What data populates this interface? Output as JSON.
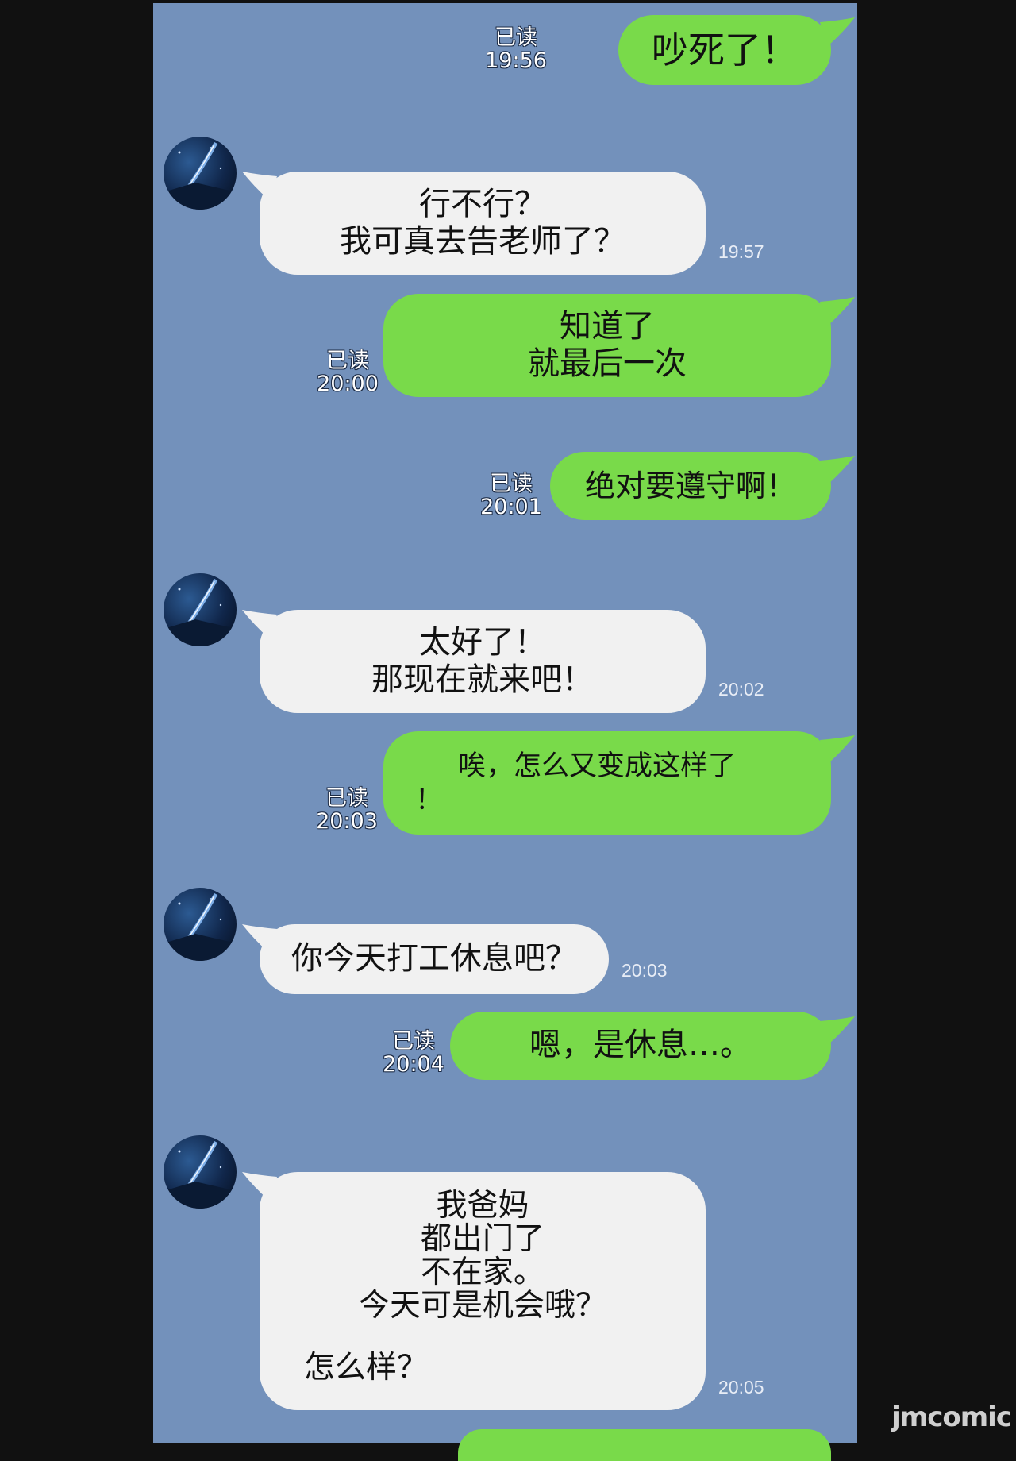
{
  "colors": {
    "chat_background": "#7391bb",
    "outgoing_bubble": "#79da4a",
    "incoming_bubble": "#f1f1f1",
    "page_background": "#111111"
  },
  "read_label": "已读",
  "messages": [
    {
      "side": "out",
      "text": "吵死了！",
      "read": "已读",
      "time": "19:56"
    },
    {
      "side": "in",
      "text": "行不行？\n我可真去告老师了？",
      "time": "19:57"
    },
    {
      "side": "out",
      "text": "知道了\n就最后一次",
      "read": "已读",
      "time": "20:00"
    },
    {
      "side": "out",
      "text": "绝对要遵守啊！",
      "read": "已读",
      "time": "20:01"
    },
    {
      "side": "in",
      "text": "太好了！\n那现在就来吧！",
      "time": "20:02"
    },
    {
      "side": "out",
      "text": "唉，怎么又变成这样了",
      "text_extra": "！",
      "read": "已读",
      "time": "20:03"
    },
    {
      "side": "in",
      "text": "你今天打工休息吧？",
      "time": "20:03"
    },
    {
      "side": "out",
      "text": "嗯，是休息…。",
      "read": "已读",
      "time": "20:04"
    },
    {
      "side": "in",
      "text": "我爸妈\n都出门了\n不在家。\n今天可是机会哦？",
      "text_extra": "怎么样？",
      "time": "20:05"
    }
  ],
  "avatar_icon": "night-sky-avatar-icon",
  "watermark": "jmcomic"
}
